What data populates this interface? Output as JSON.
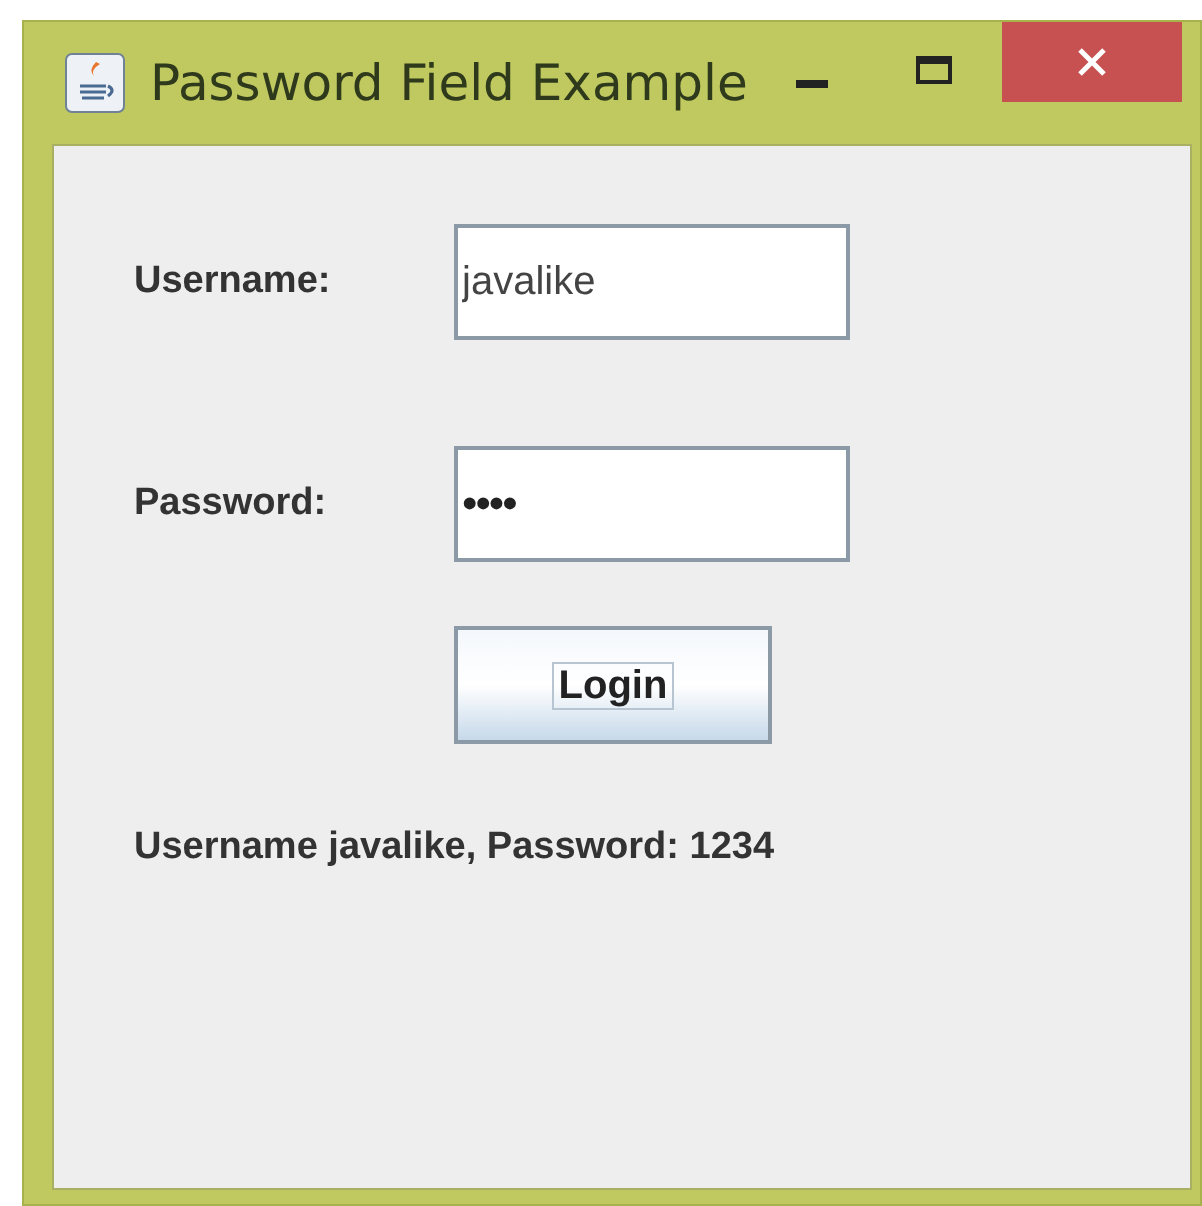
{
  "window": {
    "title": "Password Field Example"
  },
  "form": {
    "fields": [
      {
        "label": "Username:",
        "value": "javalike"
      },
      {
        "label": "Password:",
        "value": "••••"
      }
    ],
    "button": "Login",
    "result": "Username javalike, Password: 1234"
  }
}
